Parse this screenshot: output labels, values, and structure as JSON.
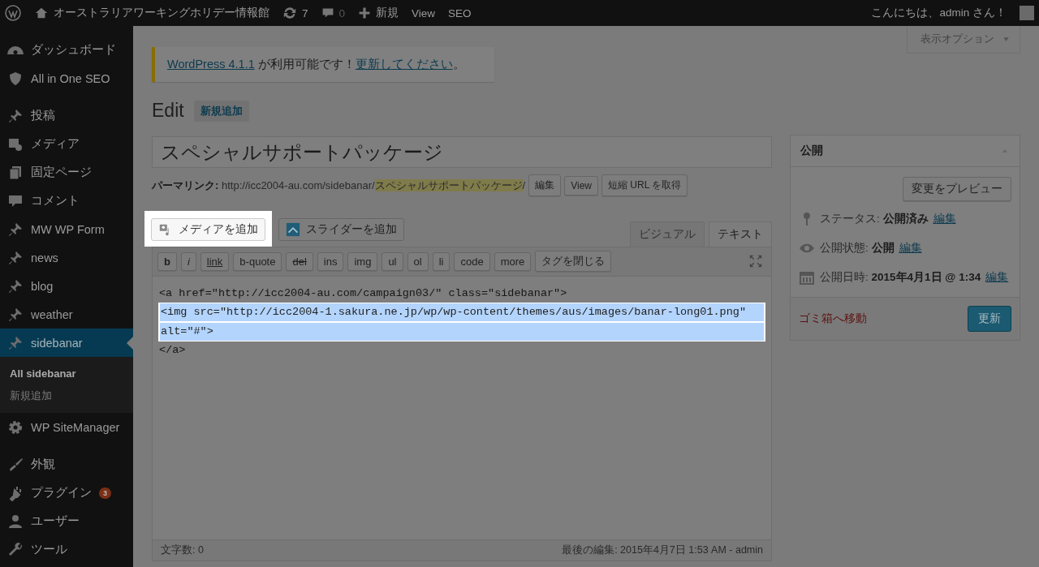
{
  "admin_bar": {
    "site_title": "オーストラリアワーキングホリデー情報館",
    "updates": "7",
    "comments": "0",
    "new": "新規",
    "links": [
      "View",
      "SEO"
    ],
    "greeting": "こんにちは、admin さん！"
  },
  "sidebar": {
    "items": [
      {
        "label": "ダッシュボード",
        "selected": false
      },
      {
        "label": "All in One SEO",
        "selected": false
      },
      {
        "label": "投稿",
        "selected": false
      },
      {
        "label": "メディア",
        "selected": false
      },
      {
        "label": "固定ページ",
        "selected": false
      },
      {
        "label": "コメント",
        "selected": false
      },
      {
        "label": "MW WP Form",
        "selected": false
      },
      {
        "label": "news",
        "selected": false
      },
      {
        "label": "blog",
        "selected": false
      },
      {
        "label": "weather",
        "selected": false
      },
      {
        "label": "sidebanar",
        "selected": true,
        "children": [
          {
            "label": "All sidebanar",
            "selected": true
          },
          {
            "label": "新規追加",
            "selected": false
          }
        ]
      },
      {
        "label": "WP SiteManager",
        "selected": false
      },
      {
        "label": "外観",
        "selected": false
      },
      {
        "label": "プラグイン",
        "selected": false,
        "badge": "3"
      },
      {
        "label": "ユーザー",
        "selected": false
      },
      {
        "label": "ツール",
        "selected": false
      }
    ]
  },
  "screen_options": "表示オプション",
  "notice": {
    "parts": [
      {
        "text": "WordPress 4.1.1",
        "kind": "link"
      },
      {
        "text": " が利用可能です！",
        "kind": "text"
      },
      {
        "text": "更新してください",
        "kind": "link"
      },
      {
        "text": "。",
        "kind": "text"
      }
    ]
  },
  "page_title": "Edit",
  "add_new": "新規追加",
  "post_title": "スペシャルサポートパッケージ",
  "permalink": {
    "label": "パーマリンク:",
    "base": "http://icc2004-au.com/sidebanar/",
    "slug": "スペシャルサポートパッケージ",
    "tail": "/",
    "buttons": [
      "編集",
      "View",
      "短縮 URL を取得"
    ]
  },
  "media_buttons": [
    {
      "label": "メディアを追加",
      "highlighted": true
    },
    {
      "label": "スライダーを追加",
      "highlighted": false
    }
  ],
  "editor_tabs": [
    {
      "label": "ビジュアル",
      "selected": false
    },
    {
      "label": "テキスト",
      "selected": true
    }
  ],
  "quicktags": [
    "b",
    "i",
    "link",
    "b-quote",
    "del",
    "ins",
    "img",
    "ul",
    "ol",
    "li",
    "code",
    "more",
    "タグを閉じる"
  ],
  "code_lines": [
    {
      "text": "<a href=\"http://icc2004-au.com/campaign03/\" class=\"sidebanar\">",
      "highlighted": false
    },
    {
      "text": "<img src=\"http://icc2004-1.sakura.ne.jp/wp/wp-content/themes/aus/images/banar-long01.png\"",
      "highlighted": true
    },
    {
      "text": "alt=\"#\">",
      "highlighted": true
    },
    {
      "text": "</a>",
      "highlighted": false
    }
  ],
  "word_count": "文字数: 0",
  "last_edit": "最後の編集: 2015年4月7日 1:53 AM - admin",
  "publish": {
    "title": "公開",
    "preview": "変更をプレビュー",
    "rows": [
      {
        "text": "ステータス: **公開済み**",
        "link": "編集"
      },
      {
        "text": "公開状態: **公開**",
        "link": "編集"
      },
      {
        "text": "公開日時: **2015年4月1日 @ 1:34**",
        "link": "編集"
      }
    ],
    "trash": "ゴミ箱へ移動",
    "update": "更新"
  }
}
